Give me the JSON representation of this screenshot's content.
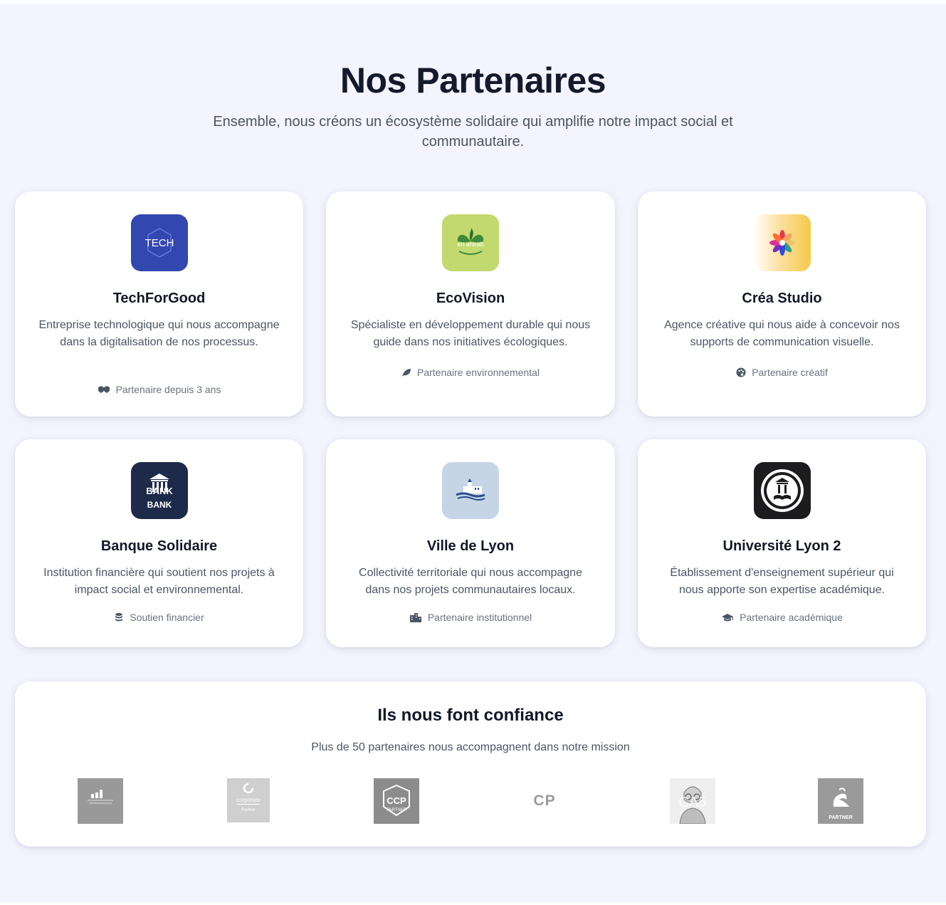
{
  "header": {
    "title": "Nos Partenaires",
    "subtitle": "Ensemble, nous créons un écosystème solidaire qui amplifie notre impact social et communautaire."
  },
  "partners": [
    {
      "name": "TechForGood",
      "description": "Entreprise technologique qui nous accompagne dans la digitalisation de nos processus.",
      "tag": "Partenaire depuis 3 ans",
      "tag_icon": "handshake-icon",
      "logo_text": "TECH",
      "logo_color": "#3347b0"
    },
    {
      "name": "EcoVision",
      "description": "Spécialiste en développement durable qui nous guide dans nos initiatives écologiques.",
      "tag": "Partenaire environnemental",
      "tag_icon": "leaf-icon",
      "logo_text": "en anirab",
      "logo_color": "#c2d96f"
    },
    {
      "name": "Créa Studio",
      "description": "Agence créative qui nous aide à concevoir nos supports de communication visuelle.",
      "tag": "Partenaire créatif",
      "tag_icon": "palette-icon",
      "logo_color": "#f5c94a"
    },
    {
      "name": "Banque Solidaire",
      "description": "Institution financière qui soutient nos projets à impact social et environnemental.",
      "tag": "Soutien financier",
      "tag_icon": "coins-icon",
      "logo_text": "BANK",
      "logo_text_top": "BANK",
      "logo_color": "#1e2a4a"
    },
    {
      "name": "Ville de Lyon",
      "description": "Collectivité territoriale qui nous accompagne dans nos projets communautaires locaux.",
      "tag": "Partenaire institutionnel",
      "tag_icon": "city-icon",
      "logo_color": "#c5d5e6"
    },
    {
      "name": "Université Lyon 2",
      "description": "Établissement d'enseignement supérieur qui nous apporte son expertise académique.",
      "tag": "Partenaire académique",
      "tag_icon": "graduation-cap-icon",
      "logo_color": "#1c1c1e"
    }
  ],
  "trust": {
    "title": "Ils nous font confiance",
    "subtitle": "Plus de 50 partenaires nous accompagnent dans notre mission",
    "logos": [
      {
        "name": "bar-chart-partner-logo",
        "text": ""
      },
      {
        "name": "corporate-partner-logo",
        "text": "corporate",
        "subtext": "Partner"
      },
      {
        "name": "ccp-partner-logo",
        "text": "CCP",
        "subtext": "PARTNER"
      },
      {
        "name": "cp-logo",
        "text": "CP"
      },
      {
        "name": "ca5-portrait-logo",
        "text": "CA5"
      },
      {
        "name": "swan-partner-logo",
        "text": "PARTNER"
      }
    ]
  },
  "colors": {
    "page_bg": "#f3f4fd",
    "card_bg": "#ffffff",
    "heading": "#141a2b",
    "body_text": "#4b5563",
    "muted": "#6b7280"
  }
}
